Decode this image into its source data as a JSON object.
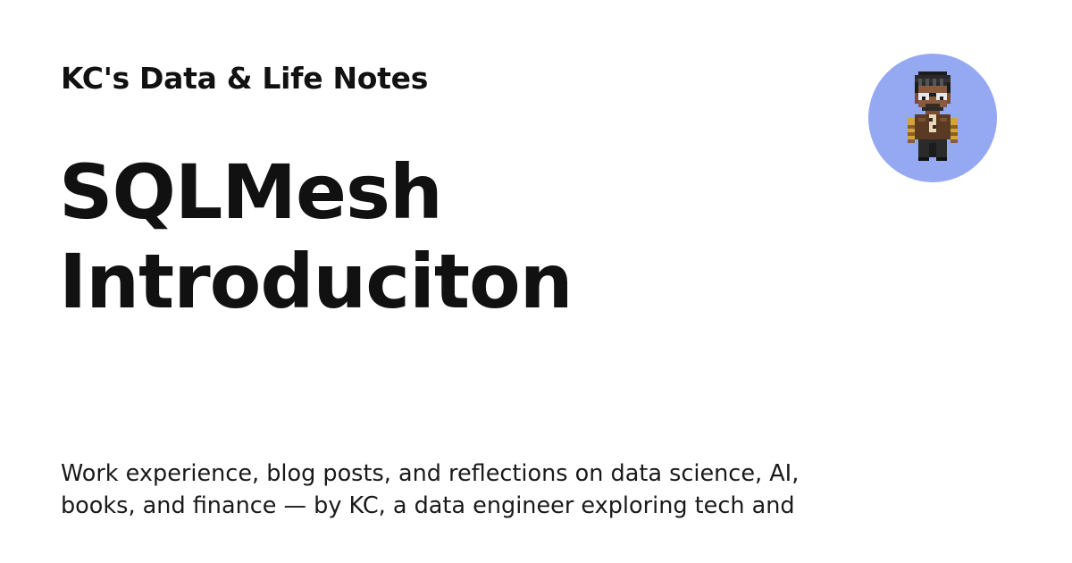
{
  "site": {
    "name": "KC's Data & Life Notes"
  },
  "post": {
    "title": "SQLMesh Introduciton",
    "description": "Work experience, blog posts, and reflections on data science, AI, books, and finance — by KC, a data engineer exploring tech and"
  },
  "avatar": {
    "icon": "pixel-art-person-avatar",
    "background_color": "#95a8f2"
  }
}
